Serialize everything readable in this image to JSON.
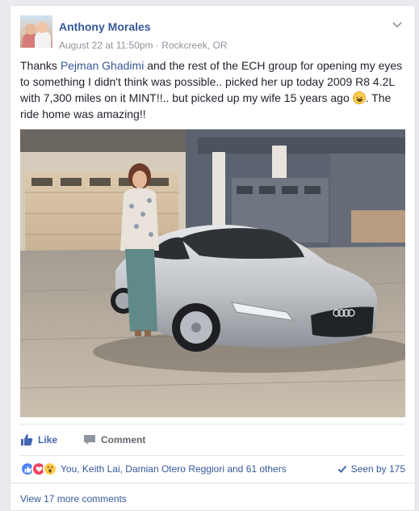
{
  "post": {
    "author": "Anthony Morales",
    "timestamp": "August 22 at 11:50pm",
    "separator": " · ",
    "location": "Rockcreek, OR",
    "text_before_mention": "Thanks ",
    "mention": "Pejman Ghadimi",
    "text_after_mention": " and the rest of the ECH group for opening my eyes to something I didn't think was possible.. picked her up today 2009 R8 4.2L with 7,300 miles on it MINT!!.. but picked up my wife 15 years ago ",
    "text_after_emoji": ". The ride home was amazing!!"
  },
  "actions": {
    "like_label": "Like",
    "comment_label": "Comment"
  },
  "reactions": {
    "summary": "You, Keith Lai, Damian Otero Reggiori and 61 others",
    "seen_by": "Seen by 175"
  },
  "comments": {
    "view_more": "View 17 more comments"
  },
  "icons": {
    "options": "chevron-down-icon",
    "emoji": "grinning-face-icon",
    "like": "thumbs-up-icon",
    "comment": "speech-bubble-icon",
    "seen": "checkmark-icon"
  },
  "colors": {
    "link": "#365899",
    "like_active": "#4267b2",
    "meta": "#90949c",
    "love": "#f0445f",
    "wow": "#ffcc4d"
  }
}
